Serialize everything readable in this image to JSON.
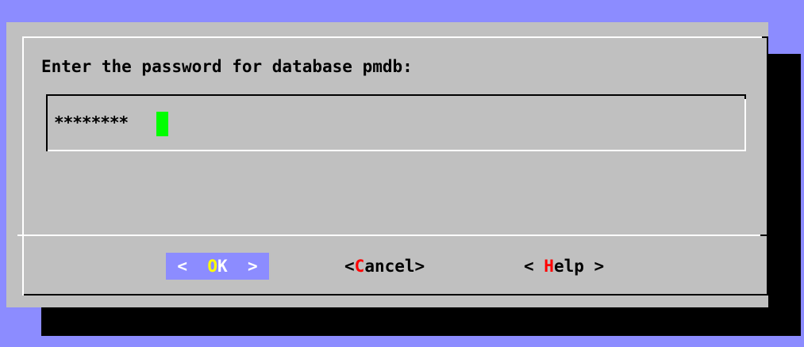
{
  "dialog": {
    "prompt": "Enter the password for database pmdb:",
    "password_value": "********"
  },
  "buttons": {
    "ok": {
      "left": "<  ",
      "hot": "O",
      "rest": "K",
      "right": "  >"
    },
    "cancel": {
      "left": "<",
      "hot": "C",
      "rest": "ancel>"
    },
    "help": {
      "left": "< ",
      "hot": "H",
      "rest": "elp >"
    }
  },
  "colors": {
    "background": "#8c8cff",
    "dialog": "#c0c0c0",
    "cursor": "#00ff00",
    "hotkey": "#ff0000",
    "selected_hotkey": "#ffff00",
    "selected_button_bg": "#8c8cff"
  }
}
